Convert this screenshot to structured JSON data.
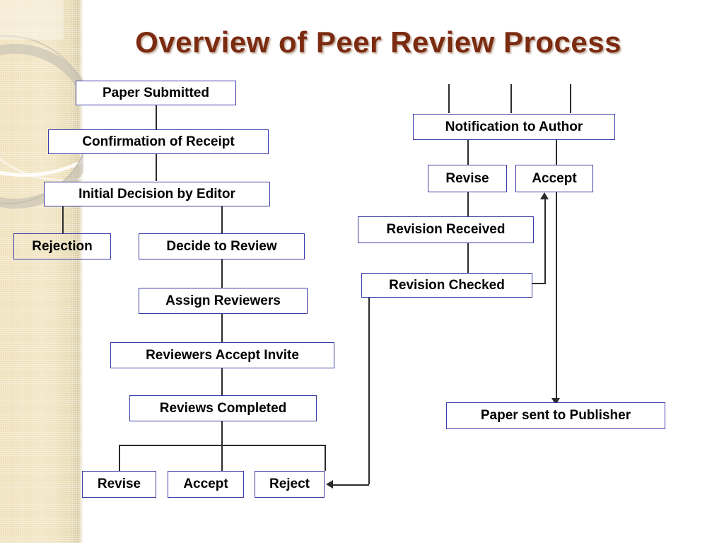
{
  "slide": {
    "title": "Overview of Peer Review Process",
    "title_color": "#7B2B10",
    "background_color": "#FFFFFF",
    "sidebar_color": "#EFE0B9",
    "box_border_color": "#3B3BA8",
    "connector_color": "#2B2B2B"
  },
  "nodes": {
    "paper_submitted": "Paper Submitted",
    "confirmation_of_receipt": "Confirmation of Receipt",
    "initial_decision_by_editor": "Initial Decision by Editor",
    "rejection": "Rejection",
    "decide_to_review": "Decide to Review",
    "assign_reviewers": "Assign Reviewers",
    "reviewers_accept_invite": "Reviewers Accept Invite",
    "reviews_completed": "Reviews Completed",
    "revise_left": "Revise",
    "accept_left": "Accept",
    "reject_left": "Reject",
    "notification_to_author": "Notification to Author",
    "revise_right": "Revise",
    "accept_right": "Accept",
    "revision_received": "Revision Received",
    "revision_checked": "Revision Checked",
    "paper_sent_to_publisher": "Paper sent to Publisher"
  },
  "chart_data": {
    "type": "diagram",
    "title": "Overview of Peer Review Process",
    "diagram_kind": "flowchart",
    "nodes": [
      {
        "id": "paper_submitted",
        "label": "Paper Submitted"
      },
      {
        "id": "confirmation_of_receipt",
        "label": "Confirmation of Receipt"
      },
      {
        "id": "initial_decision_by_editor",
        "label": "Initial Decision by Editor"
      },
      {
        "id": "rejection",
        "label": "Rejection"
      },
      {
        "id": "decide_to_review",
        "label": "Decide to Review"
      },
      {
        "id": "assign_reviewers",
        "label": "Assign Reviewers"
      },
      {
        "id": "reviewers_accept_invite",
        "label": "Reviewers Accept Invite"
      },
      {
        "id": "reviews_completed",
        "label": "Reviews Completed"
      },
      {
        "id": "revise_left",
        "label": "Revise"
      },
      {
        "id": "accept_left",
        "label": "Accept"
      },
      {
        "id": "reject_left",
        "label": "Reject"
      },
      {
        "id": "notification_to_author",
        "label": "Notification to Author"
      },
      {
        "id": "revise_right",
        "label": "Revise"
      },
      {
        "id": "accept_right",
        "label": "Accept"
      },
      {
        "id": "revision_received",
        "label": "Revision Received"
      },
      {
        "id": "revision_checked",
        "label": "Revision Checked"
      },
      {
        "id": "paper_sent_to_publisher",
        "label": "Paper sent to Publisher"
      }
    ],
    "edges": [
      {
        "from": "paper_submitted",
        "to": "confirmation_of_receipt",
        "arrow": false
      },
      {
        "from": "confirmation_of_receipt",
        "to": "initial_decision_by_editor",
        "arrow": false
      },
      {
        "from": "initial_decision_by_editor",
        "to": "rejection",
        "arrow": false
      },
      {
        "from": "initial_decision_by_editor",
        "to": "decide_to_review",
        "arrow": false
      },
      {
        "from": "decide_to_review",
        "to": "assign_reviewers",
        "arrow": false
      },
      {
        "from": "assign_reviewers",
        "to": "reviewers_accept_invite",
        "arrow": false
      },
      {
        "from": "reviewers_accept_invite",
        "to": "reviews_completed",
        "arrow": false
      },
      {
        "from": "reviews_completed",
        "to": "revise_left",
        "arrow": false
      },
      {
        "from": "reviews_completed",
        "to": "accept_left",
        "arrow": false
      },
      {
        "from": "reviews_completed",
        "to": "reject_left",
        "arrow": false
      },
      {
        "from": "revise_left",
        "to": "notification_to_author",
        "arrow": false
      },
      {
        "from": "accept_left",
        "to": "notification_to_author",
        "arrow": false
      },
      {
        "from": "reject_left",
        "to": "notification_to_author",
        "arrow": false
      },
      {
        "from": "notification_to_author",
        "to": "revise_right",
        "arrow": false
      },
      {
        "from": "notification_to_author",
        "to": "accept_right",
        "arrow": false
      },
      {
        "from": "revise_right",
        "to": "revision_received",
        "arrow": false
      },
      {
        "from": "revision_received",
        "to": "revision_checked",
        "arrow": false
      },
      {
        "from": "revision_checked",
        "to": "accept_right",
        "arrow": true
      },
      {
        "from": "revision_checked",
        "to": "reject_left",
        "arrow": true
      },
      {
        "from": "accept_right",
        "to": "paper_sent_to_publisher",
        "arrow": true
      }
    ]
  }
}
